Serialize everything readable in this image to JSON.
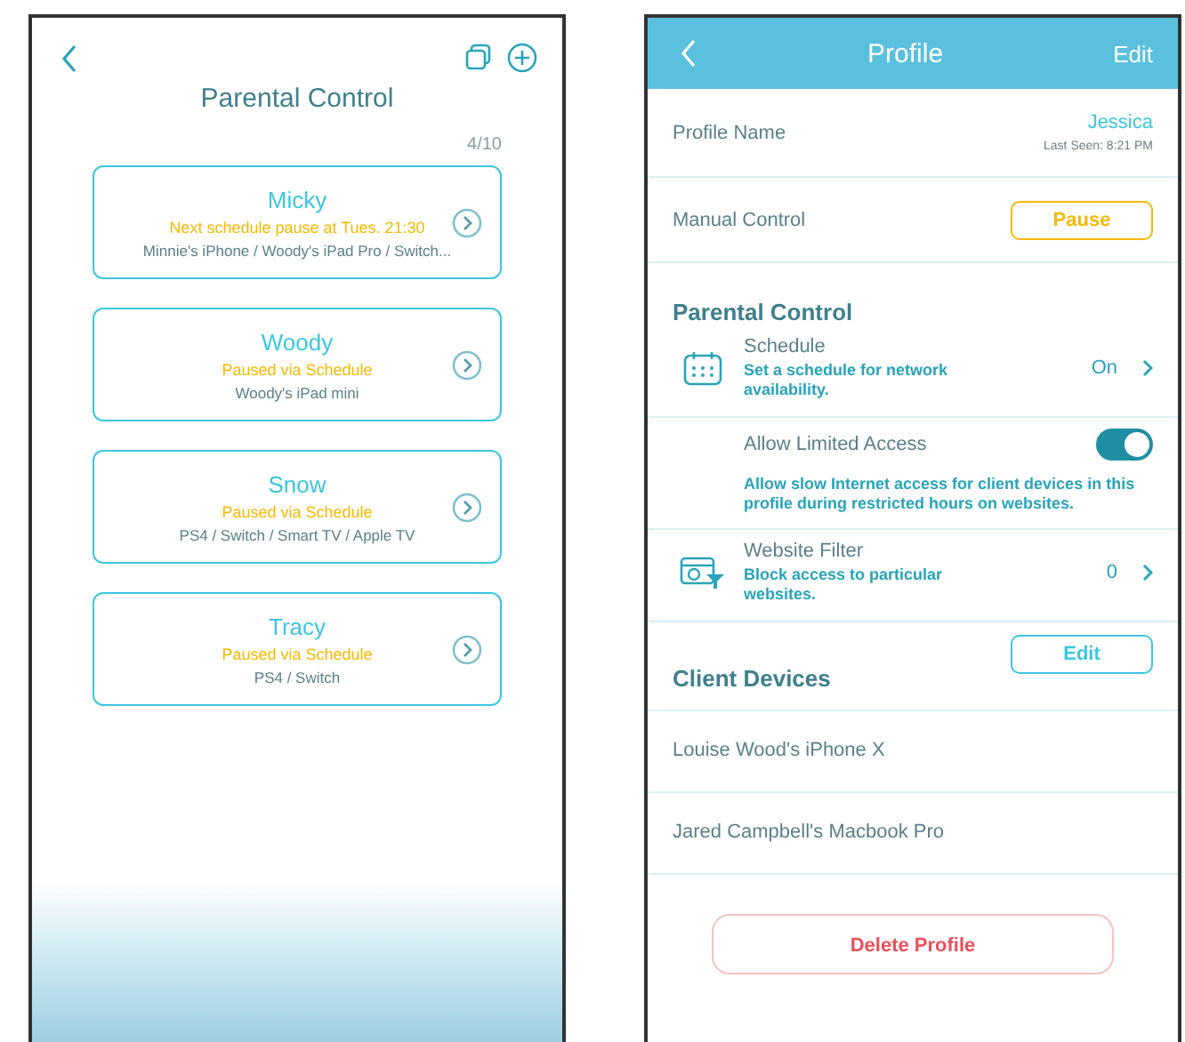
{
  "list_screen": {
    "title": "Parental Control",
    "count": "4/10",
    "profiles": [
      {
        "name": "Micky",
        "status": "Next schedule pause at Tues. 21:30",
        "devices": "Minnie's iPhone / Woody's iPad Pro / Switch..."
      },
      {
        "name": "Woody",
        "status": "Paused via Schedule",
        "devices": "Woody's iPad mini"
      },
      {
        "name": "Snow",
        "status": "Paused via Schedule",
        "devices": "PS4 / Switch / Smart TV / Apple TV"
      },
      {
        "name": "Tracy",
        "status": "Paused via Schedule",
        "devices": "PS4 / Switch"
      }
    ]
  },
  "profile_screen": {
    "title": "Profile",
    "edit": "Edit",
    "profile_name": {
      "label": "Profile Name",
      "value": "Jessica",
      "last_seen": "Last Seen: 8:21 PM"
    },
    "manual_control": {
      "label": "Manual Control",
      "button": "Pause"
    },
    "parental_control": {
      "heading": "Parental Control",
      "schedule": {
        "title": "Schedule",
        "description": "Set a schedule for network availability.",
        "value": "On"
      },
      "limited_access": {
        "title": "Allow Limited Access",
        "on": true,
        "description": "Allow slow Internet access for client devices in this profile during restricted hours on websites."
      },
      "website_filter": {
        "title": "Website Filter",
        "description": "Block access to particular websites.",
        "value": "0"
      }
    },
    "client_devices": {
      "heading": "Client Devices",
      "edit": "Edit",
      "devices": [
        "Louise Wood's iPhone X",
        "Jared Campbell's Macbook Pro"
      ]
    },
    "delete_button": "Delete Profile"
  }
}
